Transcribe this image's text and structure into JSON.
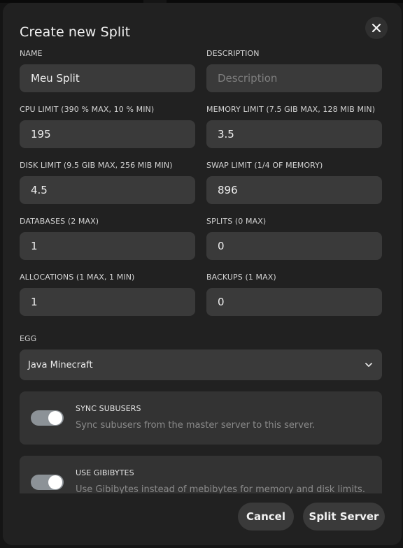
{
  "modal": {
    "title": "Create new Split"
  },
  "fields": {
    "name": {
      "label": "NAME",
      "value": "Meu Split",
      "placeholder": ""
    },
    "description": {
      "label": "DESCRIPTION",
      "value": "",
      "placeholder": "Description"
    },
    "cpu_limit": {
      "label": "CPU LIMIT (390 % MAX, 10 % MIN)",
      "value": "195"
    },
    "memory_limit": {
      "label": "MEMORY LIMIT (7.5 GIB MAX, 128 MIB MIN)",
      "value": "3.5"
    },
    "disk_limit": {
      "label": "DISK LIMIT (9.5 GIB MAX, 256 MIB MIN)",
      "value": "4.5"
    },
    "swap_limit": {
      "label": "SWAP LIMIT (1/4 OF MEMORY)",
      "value": "896"
    },
    "databases": {
      "label": "DATABASES (2 MAX)",
      "value": "1"
    },
    "splits": {
      "label": "SPLITS (0 MAX)",
      "value": "0"
    },
    "allocations": {
      "label": "ALLOCATIONS (1 MAX, 1 MIN)",
      "value": "1"
    },
    "backups": {
      "label": "BACKUPS (1 MAX)",
      "value": "0"
    }
  },
  "egg": {
    "label": "EGG",
    "selected": "Java Minecraft"
  },
  "options": [
    {
      "title": "SYNC SUBUSERS",
      "description": "Sync subusers from the master server to this server.",
      "enabled": true
    },
    {
      "title": "USE GIBIBYTES",
      "description": "Use Gibibytes instead of mebibytes for memory and disk limits.",
      "enabled": true
    }
  ],
  "footer": {
    "cancel_label": "Cancel",
    "submit_label": "Split Server"
  },
  "colors": {
    "modal_bg": "#212121",
    "input_bg": "#3a3a3a",
    "toggle_on": "#8c9297"
  },
  "icons": {
    "close": "close-icon",
    "select": "chevron-down-icon"
  }
}
